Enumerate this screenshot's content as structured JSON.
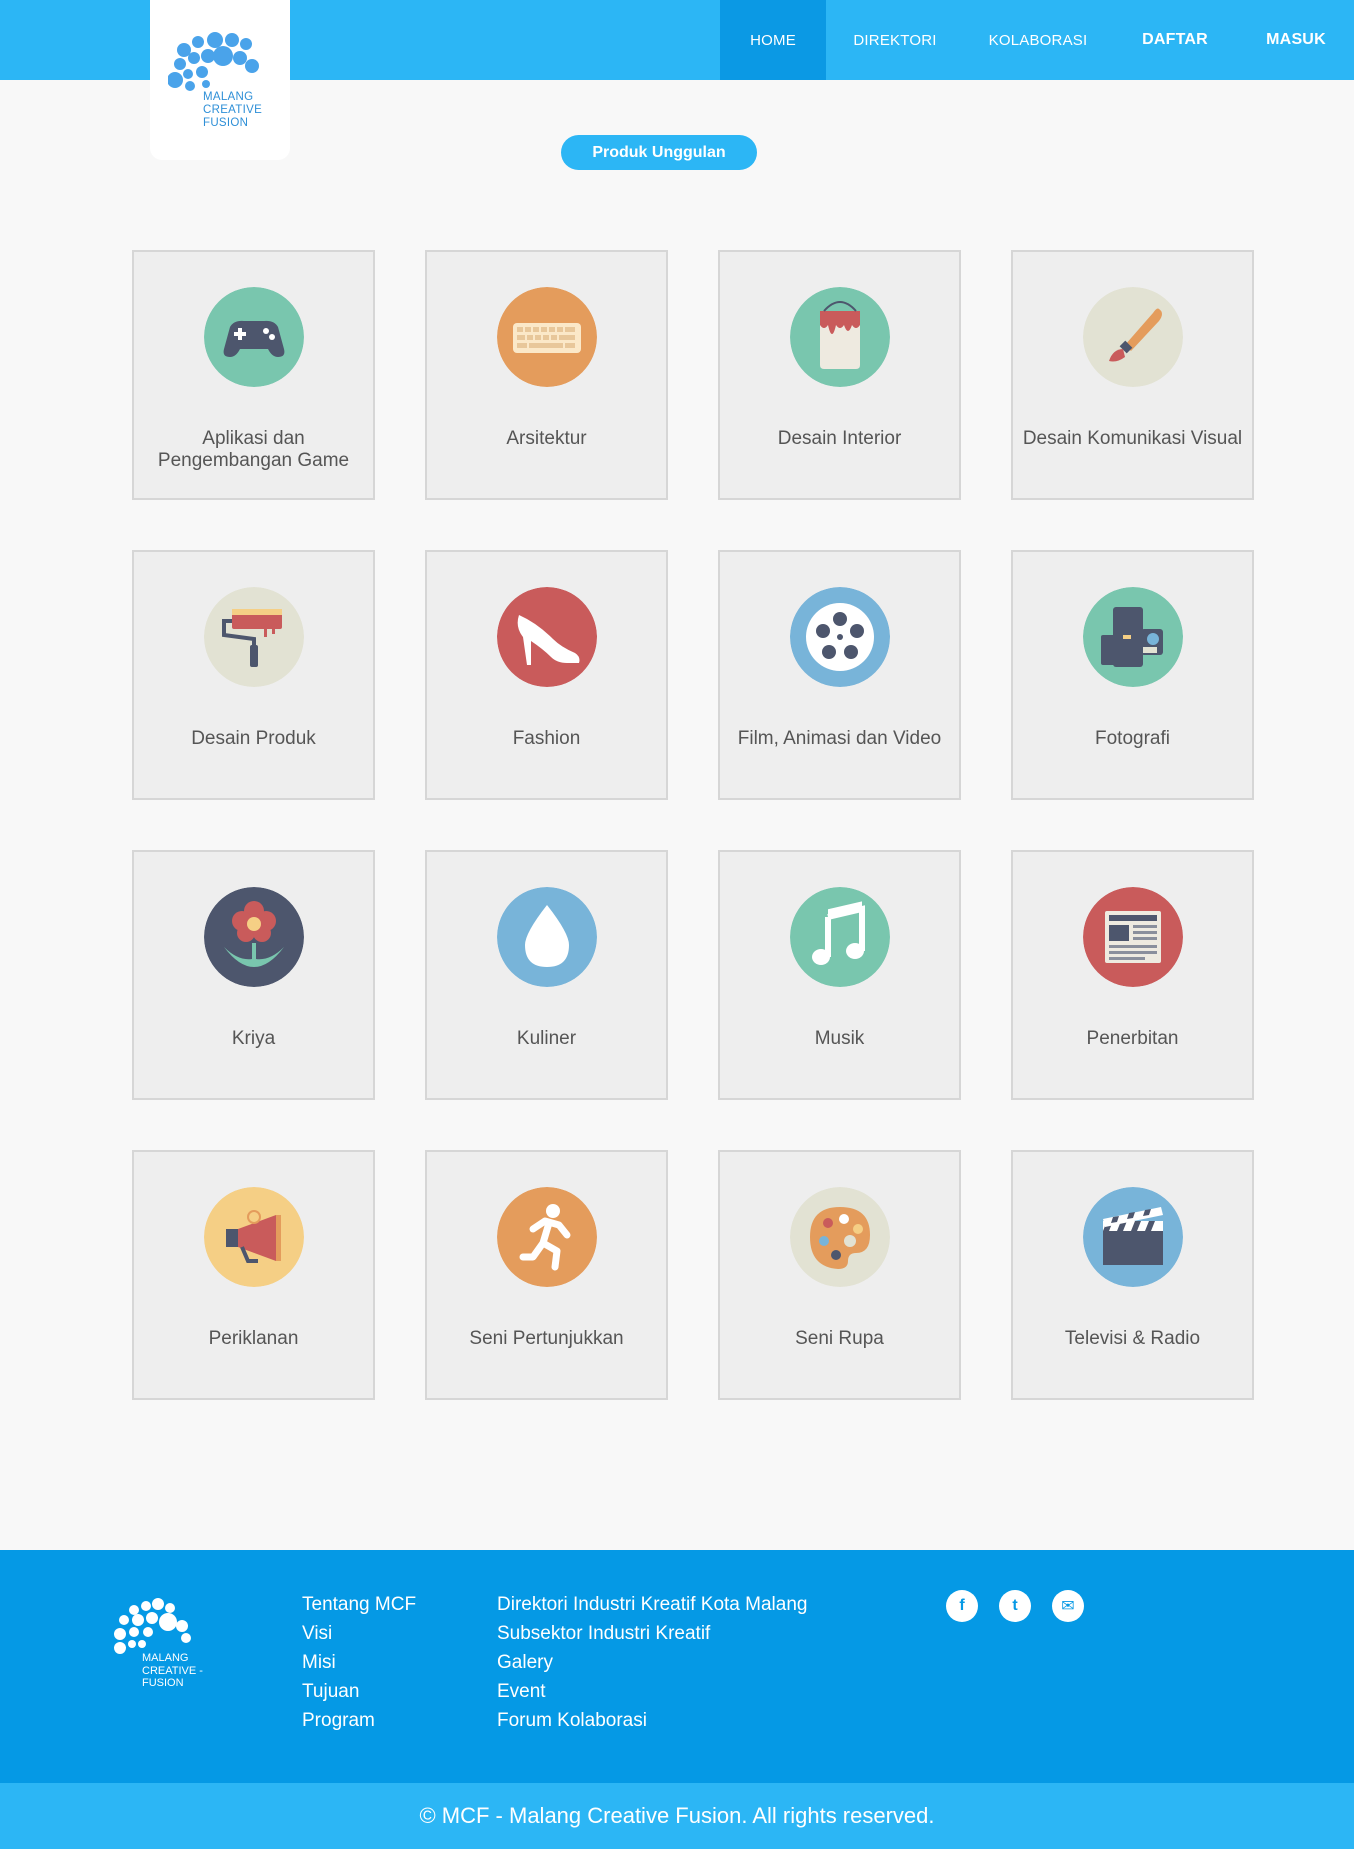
{
  "brand": {
    "logo_lines": [
      "MALANG",
      "CREATIVE",
      "FUSION"
    ],
    "primary_color": "#2cb6f5",
    "dark_blue": "#0599e5"
  },
  "nav": {
    "home": "HOME",
    "direktori": "DIREKTORI",
    "kolaborasi": "KOLABORASI",
    "daftar": "DAFTAR",
    "masuk": "MASUK",
    "active": "HOME"
  },
  "featured_button": "Produk Unggulan",
  "categories": [
    {
      "label": "Aplikasi dan Pengembangan Game",
      "icon": "gamepad-icon",
      "color": "#79c6ae"
    },
    {
      "label": "Arsitektur",
      "icon": "keyboard-icon",
      "color": "#e49c5c"
    },
    {
      "label": "Desain Interior",
      "icon": "paint-bucket-icon",
      "color": "#79c6ae"
    },
    {
      "label": "Desain Komunikasi Visual",
      "icon": "paintbrush-icon",
      "color": "#e2e2d3"
    },
    {
      "label": "Desain Produk",
      "icon": "paint-roller-icon",
      "color": "#e2e2d3"
    },
    {
      "label": "Fashion",
      "icon": "high-heel-icon",
      "color": "#c95b5b"
    },
    {
      "label": "Film, Animasi dan Video",
      "icon": "film-reel-icon",
      "color": "#78b4d9"
    },
    {
      "label": "Fotografi",
      "icon": "camera-icon",
      "color": "#79c6ae"
    },
    {
      "label": "Kriya",
      "icon": "flower-icon",
      "color": "#4d566d"
    },
    {
      "label": "Kuliner",
      "icon": "droplet-icon",
      "color": "#78b4d9"
    },
    {
      "label": "Musik",
      "icon": "music-note-icon",
      "color": "#79c6ae"
    },
    {
      "label": "Penerbitan",
      "icon": "newspaper-icon",
      "color": "#c95b5b"
    },
    {
      "label": "Periklanan",
      "icon": "megaphone-icon",
      "color": "#f5cf85"
    },
    {
      "label": "Seni Pertunjukkan",
      "icon": "running-person-icon",
      "color": "#e49c5c"
    },
    {
      "label": "Seni Rupa",
      "icon": "palette-icon",
      "color": "#e2e2d3"
    },
    {
      "label": "Televisi & Radio",
      "icon": "clapperboard-icon",
      "color": "#78b4d9"
    }
  ],
  "footer": {
    "logo_lines": [
      "MALANG",
      "CREATIVE -",
      "FUSION"
    ],
    "links_col1": [
      "Tentang MCF",
      "Visi",
      "Misi",
      "Tujuan",
      "Program"
    ],
    "links_col2": [
      "Direktori Industri Kreatif Kota Malang",
      "Subsektor Industri Kreatif",
      "Galery",
      "Event",
      "Forum Kolaborasi"
    ],
    "socials": [
      {
        "name": "facebook-icon",
        "glyph": "f"
      },
      {
        "name": "twitter-icon",
        "glyph": "t"
      },
      {
        "name": "email-icon",
        "glyph": "✉"
      }
    ],
    "copyright": "© MCF - Malang Creative Fusion. All rights reserved."
  }
}
